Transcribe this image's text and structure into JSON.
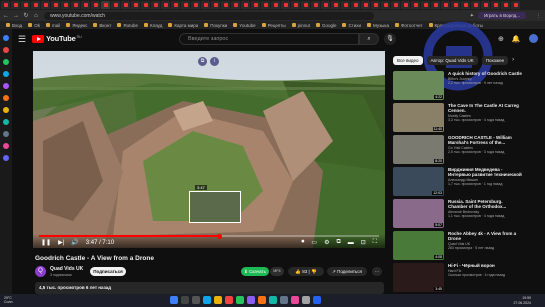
{
  "browser": {
    "url": "www.youtube.com/watch",
    "profile_label": "Играть в Ворлд...",
    "bookmarks": [
      "Вход",
      "Ok",
      "mail",
      "Яндекс",
      "Вконт",
      "Rutube",
      "Клауд",
      "Карта мира",
      "Покупки",
      "Youtube",
      "Рецепты",
      "pinnut",
      "Google",
      "Стихи",
      "Музыка",
      "Фотоотчет",
      "Краткосрочные работы"
    ]
  },
  "youtube": {
    "logo_text": "YouTube",
    "country_code": "RU",
    "search_placeholder": "Введите запрос",
    "search_icon": "search-icon",
    "mic_icon": "mic-icon"
  },
  "player": {
    "progress_fraction": 0.53,
    "preview_time": "3:47",
    "time_label": "3:47 / 7:10"
  },
  "video": {
    "title": "Goodrich Castle - A View from a Drone",
    "channel": "Quad Vids UK",
    "channel_initial": "Q",
    "subscribers": "3 подписчика",
    "subscribe_label": "Подписаться",
    "save_label": "Скачать",
    "save_sub": "MP4",
    "likes": "83",
    "share_label": "Поделиться",
    "more_label": "···",
    "views_date": "4,5 тыс. просмотров  6 лет назад"
  },
  "chips": [
    "Все видео",
    "Автор: Quad Vids UK",
    "Похожее"
  ],
  "recommendations": [
    {
      "title": "A quick history of Goodrich Castle",
      "channel": "Bilbo's Journey",
      "meta": "2,2 тыс. просмотров · 9 лет назад",
      "duration": "4:22",
      "color": "#6a8a5a"
    },
    {
      "title": "The Cave In The Castle At Carreg Cennen.",
      "channel": "Mostly Castles",
      "meta": "3,3 тыс. просмотров · 4 года назад",
      "duration": "11:40",
      "color": "#8a8068"
    },
    {
      "title": "GOODRICH CASTLE - William Marshal's Fortress of the...",
      "channel": "Go Visit Castles",
      "meta": "2,5 тыс. просмотров · 3 года назад",
      "duration": "8:20",
      "color": "#7a7a70"
    },
    {
      "title": "Вирджиния Медведева - Интервью развитие технической части",
      "channel": "Александр Мишин",
      "meta": "1,7 тыс. просмотров · 1 год назад",
      "duration": "12:03",
      "color": "#3a4a5a"
    },
    {
      "title": "Russia. Saint Petersburg. Chamber of the Orthodox...",
      "channel": "Alexandr Bedrovsky",
      "meta": "1,1 тыс. просмотров · 4 года назад",
      "duration": "5:07",
      "color": "#8a6a8a"
    },
    {
      "title": "Roche Abbey 4k - A View from a Drone",
      "channel": "Quad Vids UK",
      "meta": "263 просмотра · 5 лет назад",
      "duration": "4:08",
      "color": "#4a7a3a"
    },
    {
      "title": "Hi-Fi - Чёрный ворон",
      "channel": "Hard Fix",
      "meta": "Сколько просмотров · 4 года назад",
      "duration": "3:45",
      "color": "#2a1a1a"
    }
  ],
  "taskbar": {
    "weather_temp": "29°C",
    "weather_desc": "Солн.",
    "time": "19:59",
    "date": "27.06.2024"
  }
}
